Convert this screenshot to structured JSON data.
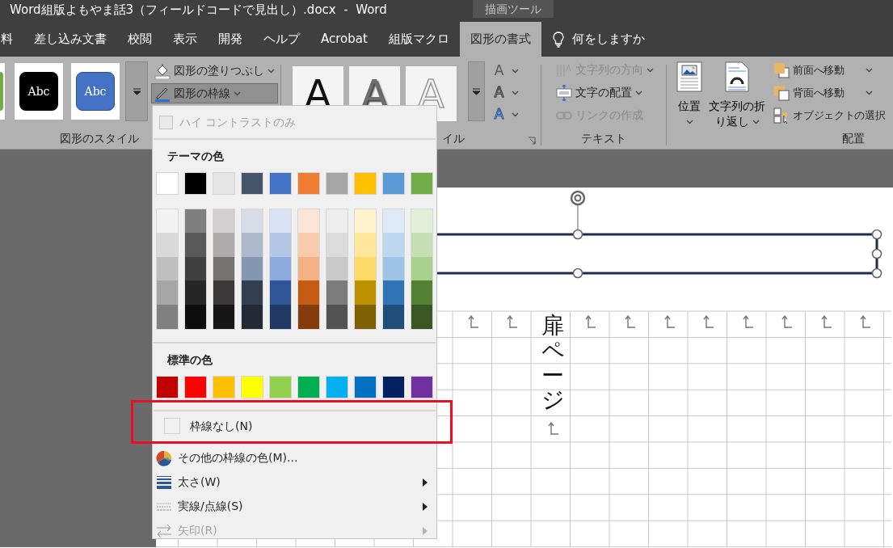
{
  "window": {
    "title": "Word組版よもやま話3（フィールドコードで見出し）.docx  -  Word",
    "context_tab": "描画ツール"
  },
  "tabs": [
    {
      "label": "料",
      "selected": false
    },
    {
      "label": "差し込み文書",
      "selected": false
    },
    {
      "label": "校閲",
      "selected": false
    },
    {
      "label": "表示",
      "selected": false
    },
    {
      "label": "開発",
      "selected": false
    },
    {
      "label": "ヘルプ",
      "selected": false
    },
    {
      "label": "Acrobat",
      "selected": false
    },
    {
      "label": "組版マクロ",
      "selected": false
    },
    {
      "label": "図形の書式",
      "selected": true
    }
  ],
  "tell_me": "何をしますか",
  "shape_styles": {
    "label": "図形のスタイル",
    "presets": [
      {
        "color": "#70ad47"
      },
      {
        "text": "Abc",
        "color": "#000000"
      },
      {
        "text": "Abc",
        "color": "#4472c4"
      }
    ],
    "commands": [
      {
        "label": "図形の塗りつぶし",
        "kind": "fill",
        "pressed": false
      },
      {
        "label": "図形の枠線",
        "kind": "outline",
        "pressed": true
      }
    ]
  },
  "wordart": {
    "label": "イル",
    "samples": [
      {
        "text": "A",
        "kind": "solid"
      },
      {
        "text": "A",
        "kind": "shadow"
      },
      {
        "text": "A",
        "kind": "outline"
      }
    ],
    "text_buttons": [
      {
        "text": "A",
        "kind": "fill"
      },
      {
        "text": "A",
        "kind": "outline"
      },
      {
        "text": "A",
        "kind": "effect"
      }
    ]
  },
  "text_group": {
    "label": "テキスト",
    "commands": [
      {
        "label": "文字列の方向",
        "kind": "direction",
        "disabled": true,
        "dropdown": true
      },
      {
        "label": "文字の配置",
        "kind": "align",
        "disabled": false,
        "dropdown": true
      },
      {
        "label": "リンクの作成",
        "kind": "link",
        "disabled": true,
        "dropdown": false
      }
    ]
  },
  "arrange": {
    "label": "配置",
    "large": [
      {
        "lines": [
          "位置"
        ],
        "kind": "position"
      },
      {
        "lines": [
          "文字列の折",
          "り返し"
        ],
        "kind": "wrap"
      }
    ],
    "commands": [
      {
        "label": "前面へ移動",
        "kind": "forward"
      },
      {
        "label": "背面へ移動",
        "kind": "backward"
      },
      {
        "label": "オブジェクトの選択",
        "kind": "select"
      }
    ]
  },
  "menu": {
    "high_contrast": {
      "label": "ハイ コントラストのみ",
      "checked": false,
      "disabled": true
    },
    "theme_heading": "テーマの色",
    "theme_colors": [
      {
        "color": "#ffffff",
        "shades": [
          {
            "color": "#f2f2f2"
          },
          {
            "color": "#d9d9d9"
          },
          {
            "color": "#bfbfbf"
          },
          {
            "color": "#a6a6a6"
          },
          {
            "color": "#808080"
          }
        ]
      },
      {
        "color": "#000000",
        "shades": [
          {
            "color": "#7f7f7f"
          },
          {
            "color": "#595959"
          },
          {
            "color": "#404040"
          },
          {
            "color": "#262626"
          },
          {
            "color": "#0d0d0d"
          }
        ]
      },
      {
        "color": "#e7e6e6",
        "shades": [
          {
            "color": "#d0cece"
          },
          {
            "color": "#aeabab"
          },
          {
            "color": "#767171"
          },
          {
            "color": "#3b3838"
          },
          {
            "color": "#171616"
          }
        ]
      },
      {
        "color": "#44546a",
        "shades": [
          {
            "color": "#d6dce5"
          },
          {
            "color": "#adb9ca"
          },
          {
            "color": "#8497b0"
          },
          {
            "color": "#333f50"
          },
          {
            "color": "#222a35"
          }
        ]
      },
      {
        "color": "#4472c4",
        "shades": [
          {
            "color": "#dae3f3"
          },
          {
            "color": "#b4c7e7"
          },
          {
            "color": "#8faadc"
          },
          {
            "color": "#2f5597"
          },
          {
            "color": "#203864"
          }
        ]
      },
      {
        "color": "#ed7d31",
        "shades": [
          {
            "color": "#fbe5d6"
          },
          {
            "color": "#f8cbad"
          },
          {
            "color": "#f4b183"
          },
          {
            "color": "#c55a11"
          },
          {
            "color": "#843c0c"
          }
        ]
      },
      {
        "color": "#a5a5a5",
        "shades": [
          {
            "color": "#ededed"
          },
          {
            "color": "#dbdbdb"
          },
          {
            "color": "#c9c9c9"
          },
          {
            "color": "#7b7b7b"
          },
          {
            "color": "#525252"
          }
        ]
      },
      {
        "color": "#ffc000",
        "shades": [
          {
            "color": "#fff2cc"
          },
          {
            "color": "#ffe699"
          },
          {
            "color": "#ffd966"
          },
          {
            "color": "#bf9000"
          },
          {
            "color": "#7f6000"
          }
        ]
      },
      {
        "color": "#5b9bd5",
        "shades": [
          {
            "color": "#deebf7"
          },
          {
            "color": "#bdd7ee"
          },
          {
            "color": "#9dc3e6"
          },
          {
            "color": "#2e75b6"
          },
          {
            "color": "#1f4e79"
          }
        ]
      },
      {
        "color": "#70ad47",
        "shades": [
          {
            "color": "#e2f0d9"
          },
          {
            "color": "#c5e0b4"
          },
          {
            "color": "#a9d18e"
          },
          {
            "color": "#548235"
          },
          {
            "color": "#385723"
          }
        ]
      }
    ],
    "standard_heading": "標準の色",
    "standard_colors": [
      {
        "color": "#c00000"
      },
      {
        "color": "#ff0000"
      },
      {
        "color": "#ffc000"
      },
      {
        "color": "#ffff00"
      },
      {
        "color": "#92d050"
      },
      {
        "color": "#00b050"
      },
      {
        "color": "#00b0f0"
      },
      {
        "color": "#0070c0"
      },
      {
        "color": "#002060"
      },
      {
        "color": "#7030a0"
      }
    ],
    "items": [
      {
        "label": "枠線なし(N)",
        "kind": "none",
        "disabled": false,
        "submenu": false
      },
      {
        "label": "その他の枠線の色(M)...",
        "kind": "more",
        "disabled": false,
        "submenu": false
      },
      {
        "label": "太さ(W)",
        "kind": "weight",
        "disabled": false,
        "submenu": true
      },
      {
        "label": "実線/点線(S)",
        "kind": "dash",
        "disabled": false,
        "submenu": true
      },
      {
        "label": "矢印(R)",
        "kind": "arrow",
        "disabled": true,
        "submenu": true
      }
    ]
  },
  "document": {
    "vertical_text": "扉ページ"
  }
}
